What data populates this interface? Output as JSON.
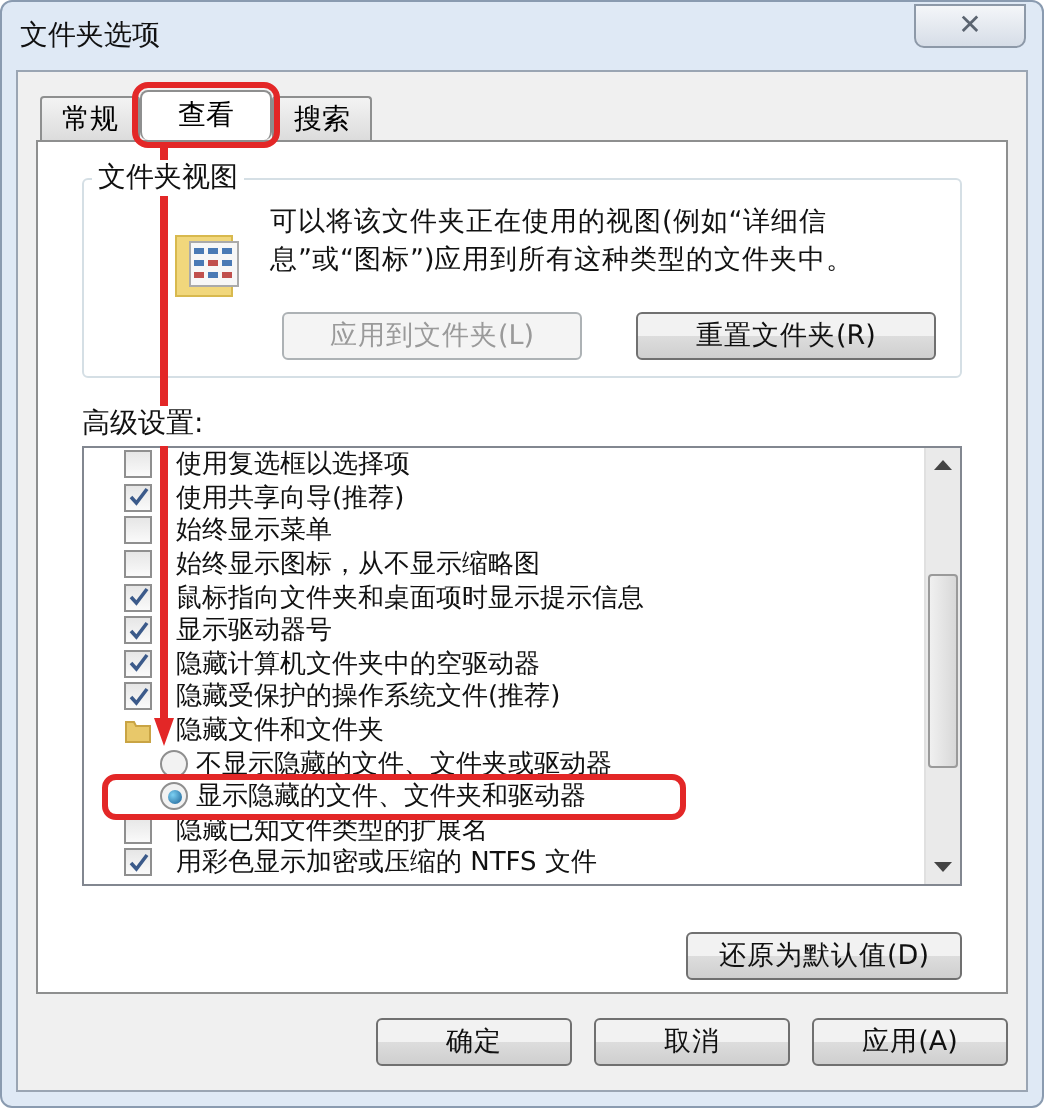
{
  "window": {
    "title": "文件夹选项",
    "close": "✕"
  },
  "tabs": [
    {
      "label": "常规",
      "selected": false,
      "highlighted": false
    },
    {
      "label": "查看",
      "selected": true,
      "highlighted": true
    },
    {
      "label": "搜索",
      "selected": false,
      "highlighted": false
    }
  ],
  "folder_views": {
    "title": "文件夹视图",
    "description": "可以将该文件夹正在使用的视图(例如“详细信息”或“图标”)应用到所有这种类型的文件夹中。",
    "buttons": [
      {
        "label": "应用到文件夹(L)",
        "disabled": true
      },
      {
        "label": "重置文件夹(R)",
        "disabled": false
      }
    ]
  },
  "advanced": {
    "title": "高级设置:",
    "items": [
      {
        "kind": "checkbox",
        "label": "使用复选框以选择项",
        "checked": false
      },
      {
        "kind": "checkbox",
        "label": "使用共享向导(推荐)",
        "checked": true
      },
      {
        "kind": "checkbox",
        "label": "始终显示菜单",
        "checked": false
      },
      {
        "kind": "checkbox",
        "label": "始终显示图标，从不显示缩略图",
        "checked": false
      },
      {
        "kind": "checkbox",
        "label": "鼠标指向文件夹和桌面项时显示提示信息",
        "checked": true
      },
      {
        "kind": "checkbox",
        "label": "显示驱动器号",
        "checked": true
      },
      {
        "kind": "checkbox",
        "label": "隐藏计算机文件夹中的空驱动器",
        "checked": true
      },
      {
        "kind": "checkbox",
        "label": "隐藏受保护的操作系统文件(推荐)",
        "checked": true
      },
      {
        "kind": "folder",
        "label": "隐藏文件和文件夹"
      },
      {
        "kind": "radio",
        "label": "不显示隐藏的文件、文件夹或驱动器",
        "selected": false,
        "highlighted": false
      },
      {
        "kind": "radio",
        "label": "显示隐藏的文件、文件夹和驱动器",
        "selected": true,
        "highlighted": true
      },
      {
        "kind": "checkbox",
        "label": "隐藏已知文件类型的扩展名",
        "checked": false
      },
      {
        "kind": "checkbox",
        "label": "用彩色显示加密或压缩的 NTFS 文件",
        "checked": true
      }
    ],
    "restore": "还原为默认值(D)"
  },
  "buttons": [
    "确定",
    "取消",
    "应用(A)"
  ]
}
